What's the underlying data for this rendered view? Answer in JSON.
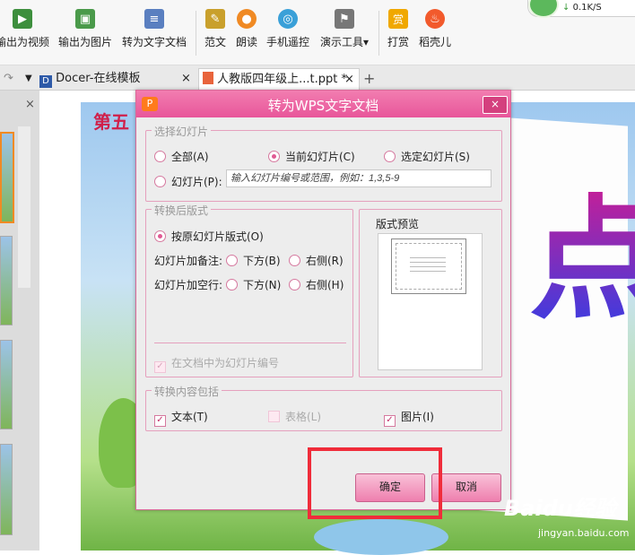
{
  "toolbar": {
    "items": [
      {
        "label": "输出为视频",
        "icon": "export-video-icon"
      },
      {
        "label": "输出为图片",
        "icon": "export-image-icon"
      },
      {
        "label": "转为文字文档",
        "icon": "convert-doc-icon"
      },
      {
        "label": "范文",
        "icon": "template-icon"
      },
      {
        "label": "朗读",
        "icon": "microphone-icon"
      },
      {
        "label": "手机遥控",
        "icon": "phone-remote-icon"
      },
      {
        "label": "演示工具",
        "icon": "presentation-tool-icon"
      },
      {
        "label": "打赏",
        "icon": "reward-icon",
        "glyph": "赏"
      },
      {
        "label": "稻壳儿",
        "icon": "docer-icon"
      }
    ],
    "dropdown_glyph": "▾",
    "speed": "0.1K/S"
  },
  "tabs": [
    {
      "label": "Docer-在线模板",
      "close": "×"
    },
    {
      "label": "人教版四年级上...t.ppt *",
      "close": "×"
    }
  ],
  "tab_add": "+",
  "slide": {
    "title": "第五",
    "character": "点"
  },
  "dialog": {
    "title": "转为WPS文字文档",
    "close": "×",
    "logo": "P",
    "select_group": {
      "label": "选择幻灯片",
      "all": "全部(A)",
      "current": "当前幻灯片(C)",
      "selected": "选定幻灯片(S)",
      "range_label": "幻灯片(P):",
      "range_placeholder": "输入幻灯片编号或范围，例如：1,3,5-9"
    },
    "layout_group": {
      "label": "转换后版式",
      "original": "按原幻灯片版式(O)",
      "notes_label": "幻灯片加备注:",
      "notes_below": "下方(B)",
      "notes_right": "右侧(R)",
      "blank_label": "幻灯片加空行:",
      "blank_below": "下方(N)",
      "blank_right": "右侧(H)",
      "numbering": "在文档中为幻灯片编号"
    },
    "preview_label": "版式预览",
    "content_group": {
      "label": "转换内容包括",
      "text": "文本(T)",
      "table": "表格(L)",
      "image": "图片(I)"
    },
    "ok": "确定",
    "cancel": "取消"
  },
  "watermark": {
    "brand": "Baidu经验",
    "url": "jingyan.baidu.com"
  }
}
